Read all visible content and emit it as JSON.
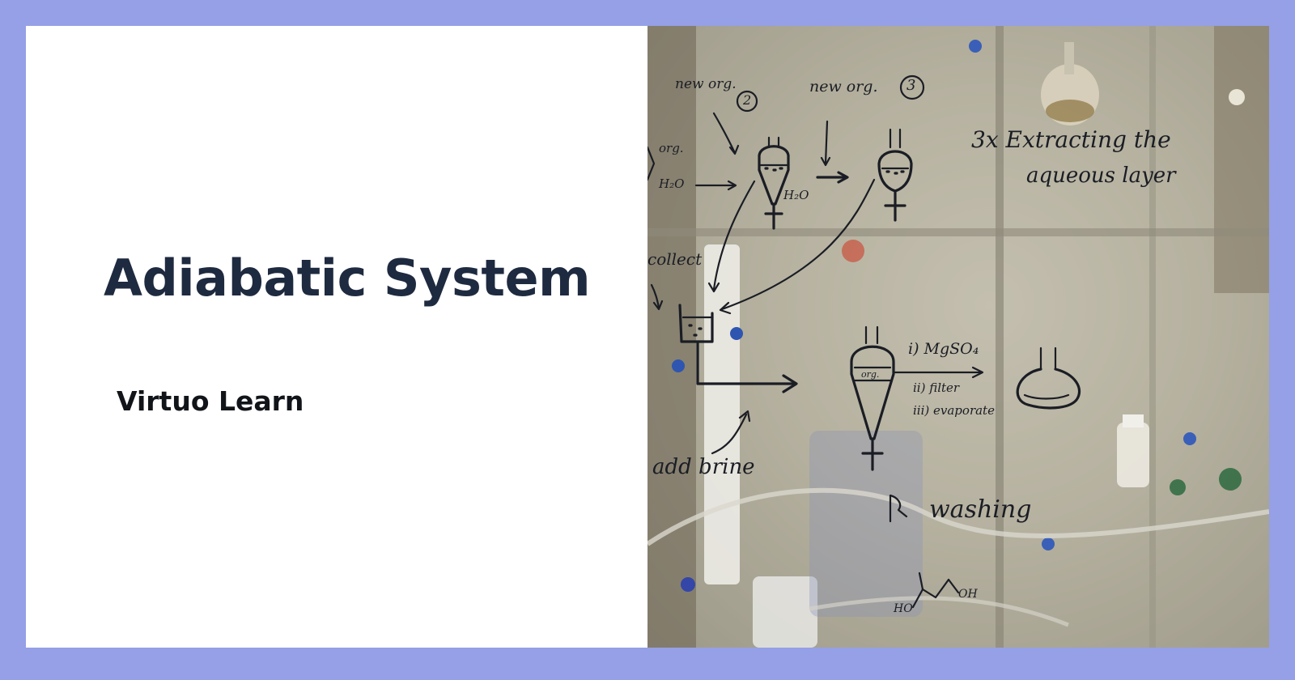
{
  "slide": {
    "title": "Adiabatic System",
    "brand": "Virtuo Learn"
  },
  "photo": {
    "alt": "Whiteboard diagram of a lab extraction procedure drawn on glass in front of laboratory equipment",
    "annotations": {
      "new_org_2": "new org.",
      "circle_2": "2",
      "new_org_3": "new org.",
      "circle_3": "3",
      "extracting_line1": "3x Extracting the",
      "extracting_line2": "aqueous layer",
      "org": "org.",
      "h2o_left": "H₂O",
      "h2o_mid": "H₂O",
      "collect": "collect",
      "org_funnel": "org.",
      "step_i": "i) MgSO₄",
      "step_ii": "ii) filter",
      "step_iii": "iii) evaporate",
      "add_brine": "add brine",
      "washing": "washing",
      "ho": "HO",
      "oh": "OH"
    }
  },
  "colors": {
    "frame": "#95a0e6",
    "title": "#1e2a3f",
    "brand": "#111418",
    "ink": "#1a1d24"
  }
}
